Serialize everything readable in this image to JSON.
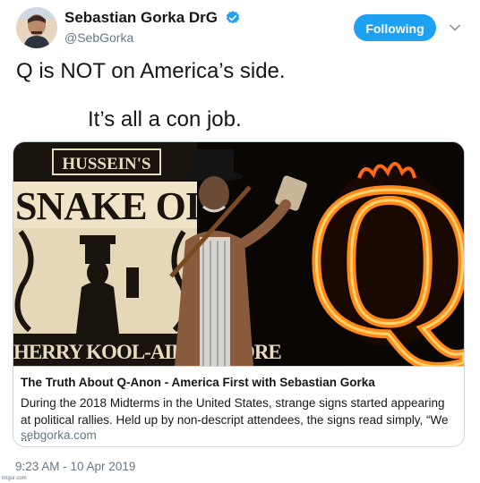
{
  "user": {
    "display_name": "Sebastian Gorka DrG",
    "handle": "@SebGorka",
    "verified_icon": "verified-badge-icon",
    "avatar_icon": "avatar"
  },
  "follow_button": {
    "label": "Following",
    "color": "#1da1f2"
  },
  "menu": {
    "icon": "chevron-down-icon"
  },
  "tweet": {
    "line1": "Q is NOT on America’s side.",
    "line2": "It’s all a con job."
  },
  "card": {
    "image_texts": {
      "sign_top": "HUSSEIN'S",
      "sign_main": "SNAKE OI",
      "sign_bottom": "HERRY KOOL-AID FLAVORE",
      "letter": "Q"
    },
    "title": "The Truth About Q-Anon - America First with Sebastian Gorka",
    "description": "During the 2018 Midterms in the United States, strange signs started appearing at political rallies. Held up by non-descript attendees, the signs read simply, “We ...",
    "domain": "sebgorka.com"
  },
  "timestamp": "9:23 AM - 10 Apr 2019",
  "corner_note": "imgur.com",
  "colors": {
    "text": "#14171a",
    "secondary": "#657786",
    "border": "#ccd6dd",
    "accent": "#1da1f2"
  }
}
